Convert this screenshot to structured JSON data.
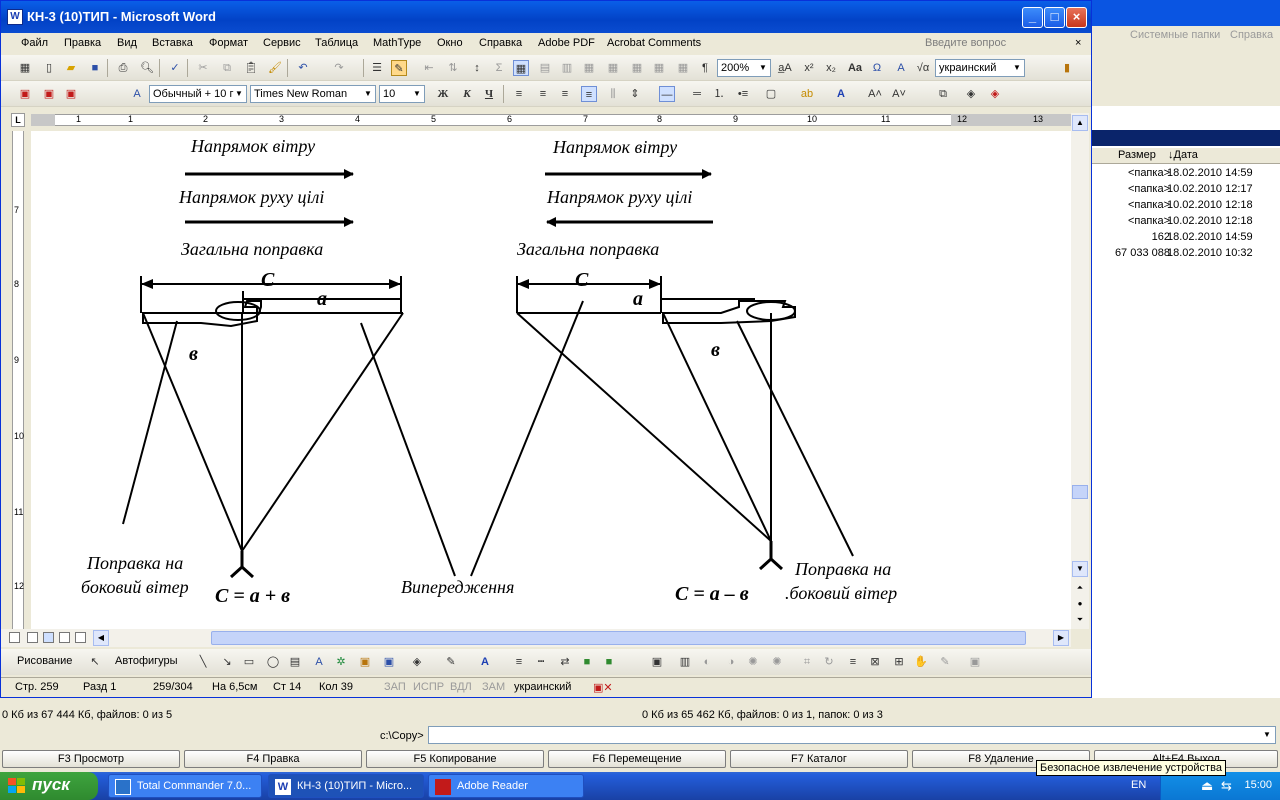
{
  "word": {
    "title": "КН-3 (10)ТИП - Microsoft Word",
    "icon": "word-doc-icon",
    "menu": [
      "Файл",
      "Правка",
      "Вид",
      "Вставка",
      "Формат",
      "Сервис",
      "Таблица",
      "MathType",
      "Окно",
      "Справка",
      "Adobe PDF",
      "Acrobat Comments"
    ],
    "ask_placeholder": "Введите вопрос",
    "zoom": "200%",
    "language": "украинский",
    "style": "Обычный + 10 г",
    "font": "Times New Roman",
    "font_size": "10",
    "ruler_numbers": [
      "1",
      "1",
      "2",
      "3",
      "4",
      "5",
      "6",
      "7",
      "8",
      "9",
      "10",
      "11",
      "12",
      "13"
    ],
    "vruler_numbers": [
      "7",
      "8",
      "9",
      "10",
      "11",
      "12"
    ],
    "draw_label": "Рисование",
    "autoshapes_label": "Автофигуры",
    "status": {
      "page": "Стр.  259",
      "section": "Разд  1",
      "pages": "259/304",
      "at": "На 6,5см",
      "line": "Ст  14",
      "col": "Кол  39",
      "rec": "ЗАП",
      "trk": "ИСПР",
      "ext": "ВДЛ",
      "ovr": "ЗАМ",
      "lang": "украинский"
    }
  },
  "diagram": {
    "wind_left": "Напрямок вітру",
    "target_left": "Напрямок руху цілі",
    "total_left": "Загальна поправка",
    "wind_right": "Напрямок вітру",
    "target_right": "Напрямок руху цілі",
    "total_right": "Загальна поправка",
    "c_left": "C",
    "a_left": "a",
    "b_left": "в",
    "c_right": "C",
    "a_right": "a",
    "b_right": "в",
    "side_wind_left": [
      "Поправка на",
      "боковий вітер"
    ],
    "formula_left": "C = a + в",
    "lead": "Випередження",
    "formula_right": "C =  a – в",
    "side_wind_right": [
      "Поправка на",
      ".боковий вітер"
    ]
  },
  "tc": {
    "menu_right": [
      "Системные папки",
      "Справка"
    ],
    "columns": [
      "Размер",
      "↓Дата"
    ],
    "rows": [
      {
        "size": "<папка>",
        "date": "18.02.2010 14:59"
      },
      {
        "size": "<папка>",
        "date": "10.02.2010 12:17"
      },
      {
        "size": "<папка>",
        "date": "10.02.2010 12:18"
      },
      {
        "size": "<папка>",
        "date": "10.02.2010 12:18"
      },
      {
        "size": "162",
        "date": "18.02.2010 14:59"
      },
      {
        "size": "67 033 088",
        "date": "18.02.2010 10:32"
      }
    ],
    "info_left": "0 Кб из 67 444 Кб, файлов: 0 из 5",
    "info_right": "0 Кб из 65 462 Кб, файлов: 0 из 1, папок: 0 из 3",
    "cmd_label": "c:\\Copy>",
    "fkeys": [
      "F3 Просмотр",
      "F4 Правка",
      "F5 Копирование",
      "F6 Перемещение",
      "F7 Каталог",
      "F8 Удаление",
      "Alt+F4 Выход"
    ]
  },
  "taskbar": {
    "start": "пуск",
    "tasks": [
      "Total Commander 7.0...",
      "КН-3 (10)ТИП - Micro...",
      "Adobe Reader"
    ],
    "lang": "EN",
    "clock": "15:00",
    "tooltip": "Безопасное извлечение устройства"
  },
  "colors": {
    "title_blue": "#0a4cd0",
    "taskbar_blue": "#245edb",
    "start_green": "#3ea43e"
  }
}
